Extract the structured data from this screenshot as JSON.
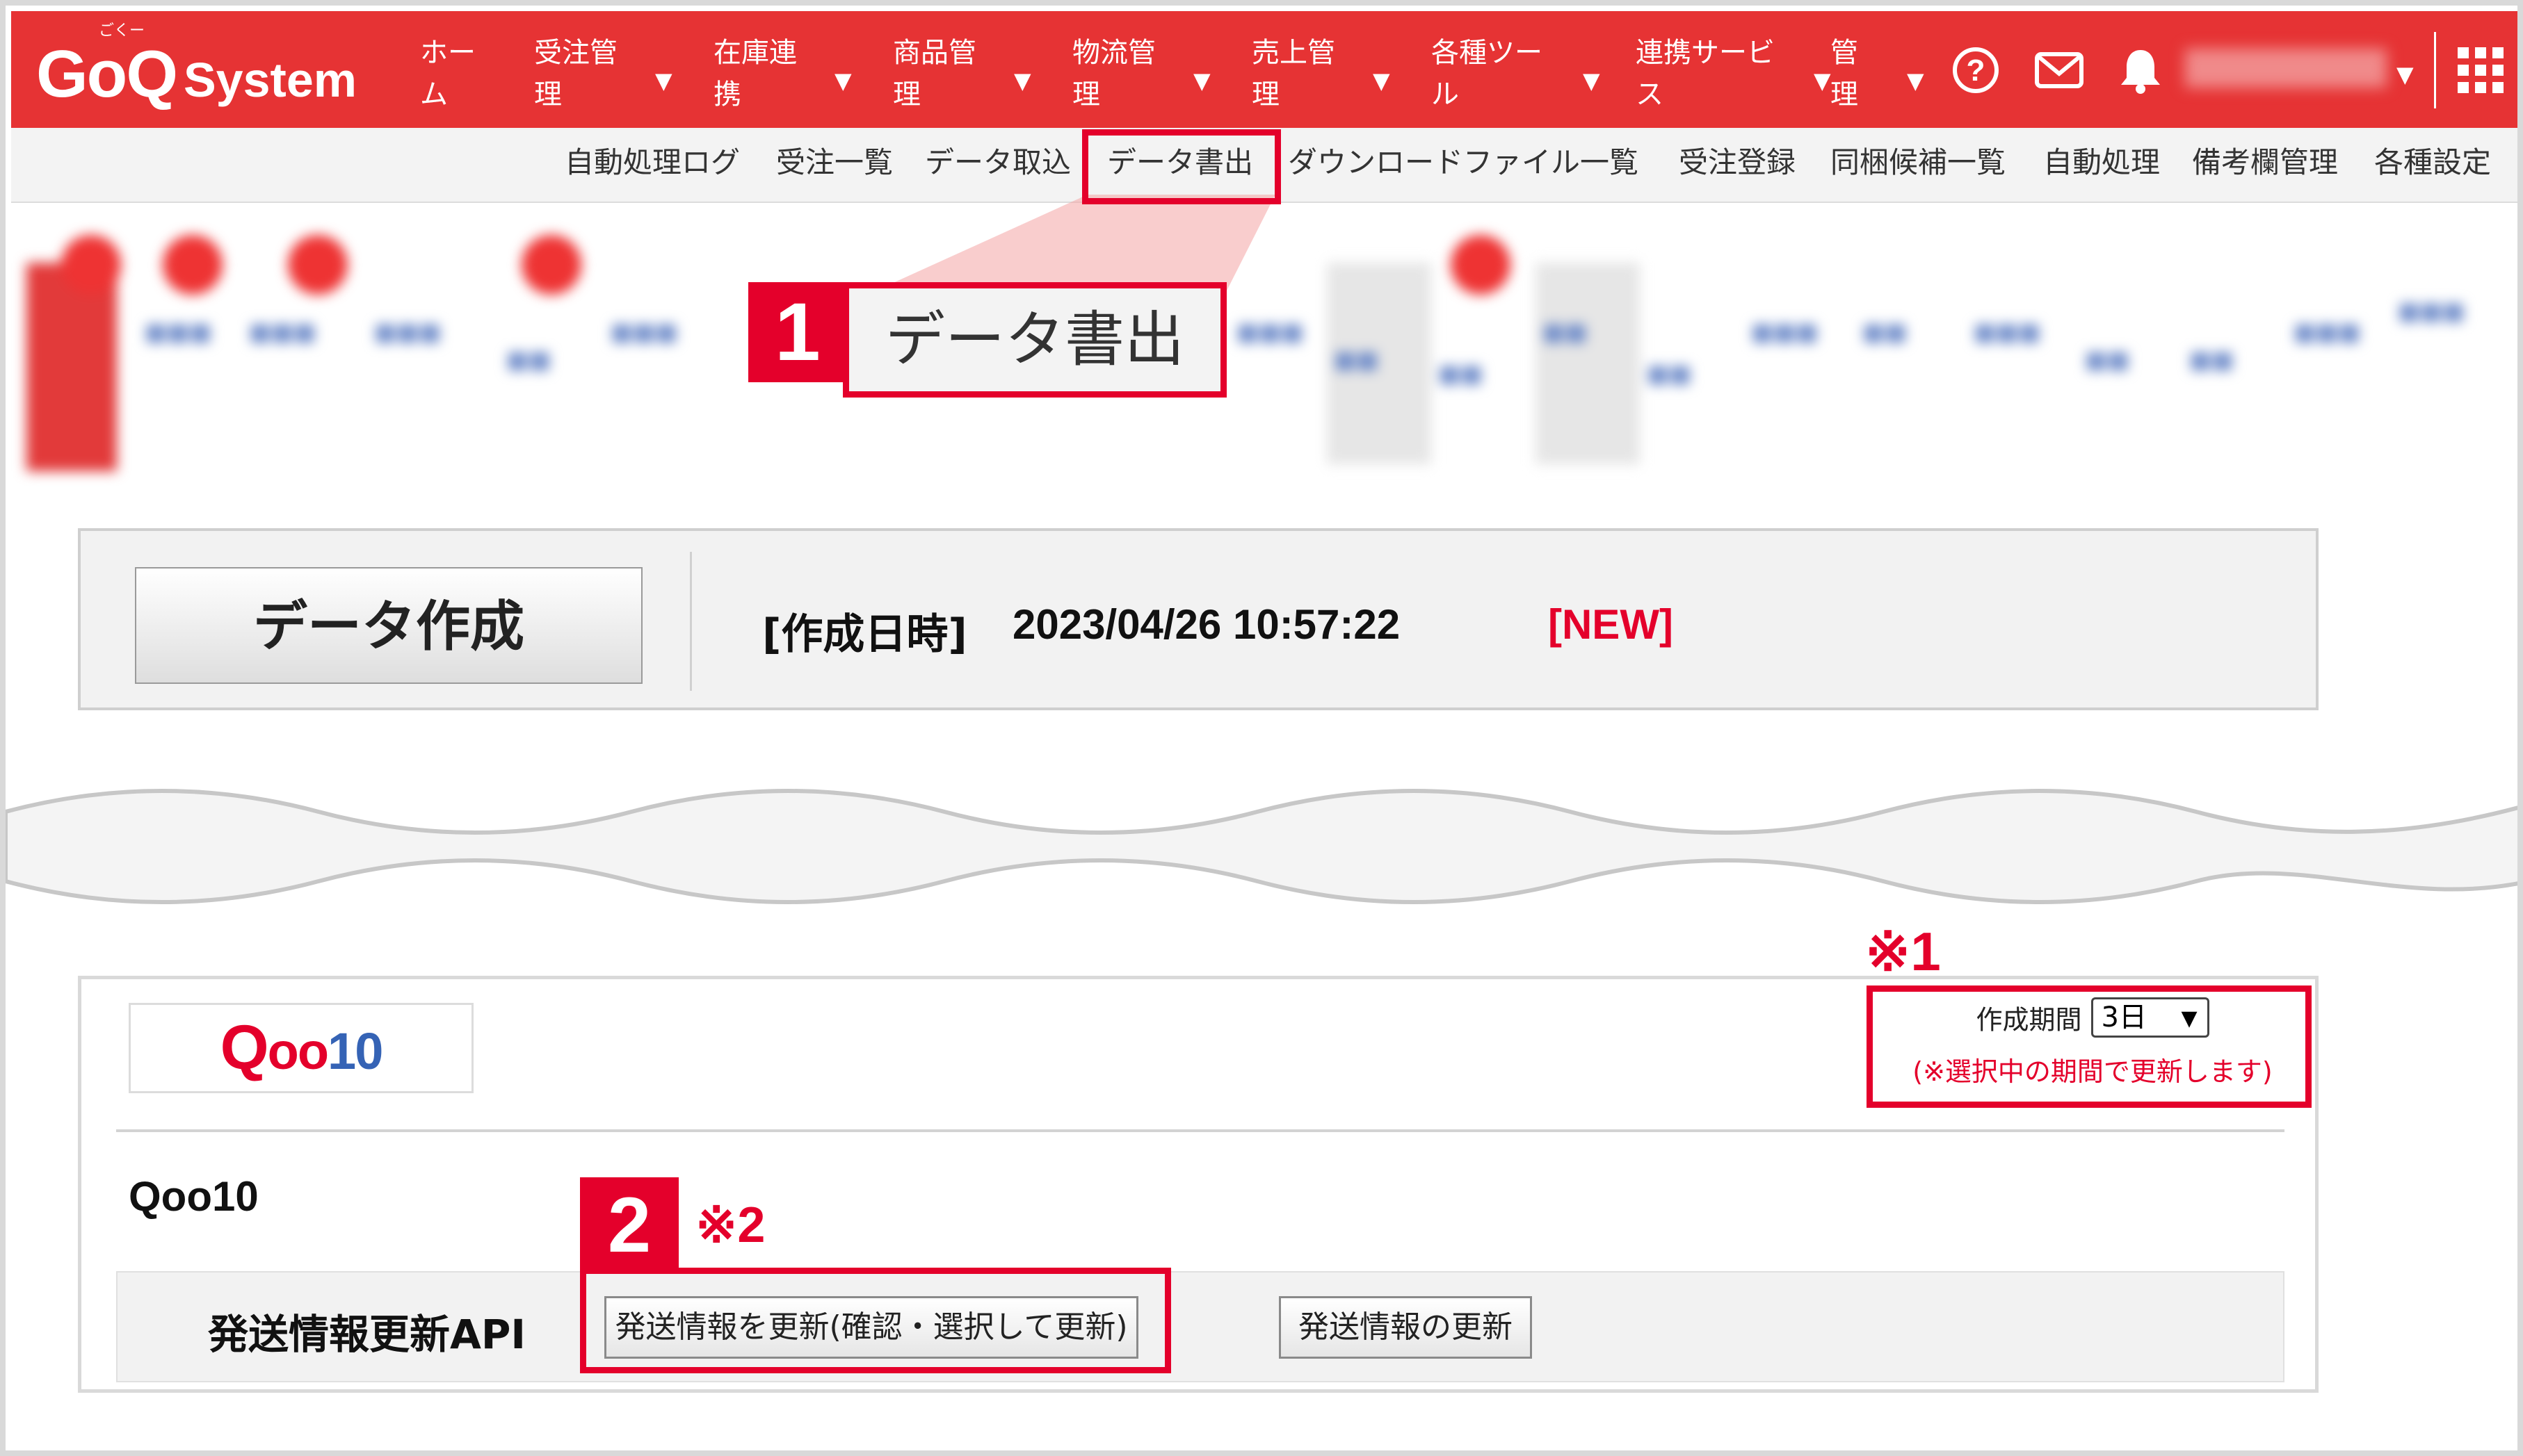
{
  "colors": {
    "brand_red": "#e63334",
    "annotation_red": "#e4002b",
    "link_blue": "#3563b5"
  },
  "header": {
    "logo_ruby": "ごくー",
    "logo_main": "GoQ",
    "logo_sub": "System",
    "nav": [
      {
        "label": "ホーム",
        "has_caret": false
      },
      {
        "label": "受注管理",
        "has_caret": true
      },
      {
        "label": "在庫連携",
        "has_caret": true
      },
      {
        "label": "商品管理",
        "has_caret": true
      },
      {
        "label": "物流管理",
        "has_caret": true
      },
      {
        "label": "売上管理",
        "has_caret": true
      },
      {
        "label": "各種ツール",
        "has_caret": true
      },
      {
        "label": "連携サービス",
        "has_caret": true
      },
      {
        "label": "管理",
        "has_caret": true
      }
    ],
    "icons": [
      "help-icon",
      "mail-icon",
      "bell-icon",
      "apps-grid-icon"
    ]
  },
  "subnav": {
    "items": [
      "自動処理ログ",
      "受注一覧",
      "データ取込",
      "データ書出",
      "ダウンロードファイル一覧",
      "受注登録",
      "同梱候補一覧",
      "自動処理",
      "備考欄管理",
      "各種設定"
    ]
  },
  "callout": {
    "step1_number": "1",
    "step1_label": "データ書出",
    "step2_number": "2",
    "note1": "※1",
    "note2": "※2"
  },
  "create": {
    "button_label": "データ作成",
    "created_label": "[作成日時]",
    "created_value": "2023/04/26 10:57:22",
    "new_badge": "[NEW]"
  },
  "qoo10": {
    "logo_text": "Qoo10",
    "name": "Qoo10",
    "period_label": "作成期間",
    "period_value": "3日",
    "period_note": "(※選択中の期間で更新します)",
    "api_label": "発送情報更新API",
    "btn_confirm_update": "発送情報を更新(確認・選択して更新)",
    "btn_update": "発送情報の更新"
  }
}
